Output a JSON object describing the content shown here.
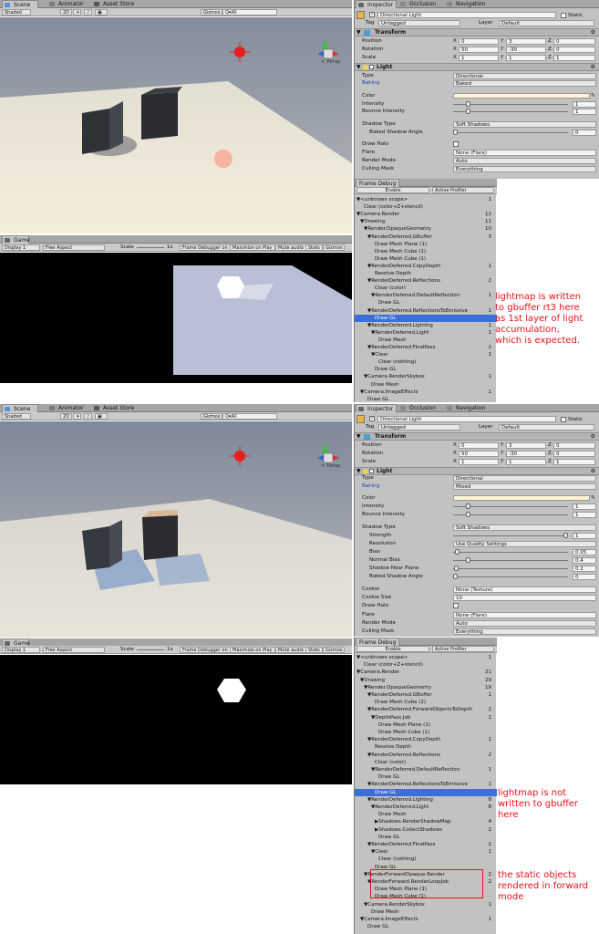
{
  "panelA": {
    "scene_tabs": [
      "Scene",
      "Animator",
      "Asset Store"
    ],
    "scene_toolbar": {
      "shading": "Shaded",
      "mode2d": "2D",
      "gizmos": "Gizmos",
      "search": "Q▾All"
    },
    "persp": "< Persp",
    "game_tab": "Game",
    "game_toolbar": {
      "display": "Display 1",
      "aspect": "Free Aspect",
      "scale": "Scale",
      "scale_val": "1x",
      "frame_debugger": "Frame Debugger on",
      "max_on_play": "Maximize on Play",
      "mute": "Mute audio",
      "stats": "Stats",
      "gizmos": "Gizmos"
    },
    "inspector_tabs": [
      "Inspector",
      "Occlusion",
      "Navigation"
    ],
    "object_name": "Directional Light",
    "static": "Static",
    "tag_label": "Tag",
    "tag": "Untagged",
    "layer_label": "Layer",
    "layer": "Default",
    "transform": {
      "title": "Transform",
      "position": "Position",
      "rotation": "Rotation",
      "scale": "Scale",
      "px": "0",
      "py": "3",
      "pz": "0",
      "rx": "50",
      "ry": "-30",
      "rz": "0",
      "sx": "1",
      "sy": "1",
      "sz": "1"
    },
    "light": {
      "title": "Light",
      "type_label": "Type",
      "type": "Directional",
      "baking_label": "Baking",
      "baking": "Baked",
      "color": "Color",
      "intensity": "Intensity",
      "intensity_val": "1",
      "bounce": "Bounce Intensity",
      "bounce_val": "1",
      "shadow_type": "Shadow Type",
      "shadow_type_val": "Soft Shadows",
      "baked_angle": "Baked Shadow Angle",
      "baked_angle_val": "0",
      "draw_halo": "Draw Halo",
      "flare": "Flare",
      "flare_val": "None (Flare)",
      "render_mode": "Render Mode",
      "render_mode_val": "Auto",
      "culling": "Culling Mask",
      "culling_val": "Everything"
    },
    "frame_debug": {
      "title": "Frame Debug",
      "enable": "Enable",
      "profiler": "Active Profiler",
      "rows": [
        {
          "t": "▼<unknown scope>",
          "n": "1",
          "d": 0
        },
        {
          "t": "Clear (color+Z+stencil)",
          "n": "",
          "d": 2
        },
        {
          "t": "▼Camera.Render",
          "n": "12",
          "d": 0
        },
        {
          "t": "▼Drawing",
          "n": "11",
          "d": 1
        },
        {
          "t": "▼Render.OpaqueGeometry",
          "n": "10",
          "d": 2
        },
        {
          "t": "▼RenderDeferred.GBuffer",
          "n": "3",
          "d": 3
        },
        {
          "t": "Draw Mesh Plane (1)",
          "n": "",
          "d": 5
        },
        {
          "t": "Draw Mesh Cube (1)",
          "n": "",
          "d": 5
        },
        {
          "t": "Draw Mesh Cube (1)",
          "n": "",
          "d": 5
        },
        {
          "t": "▼RenderDeferred.CopyDepth",
          "n": "1",
          "d": 3
        },
        {
          "t": "Resolve Depth",
          "n": "",
          "d": 5
        },
        {
          "t": "▼RenderDeferred.Reflections",
          "n": "2",
          "d": 3
        },
        {
          "t": "Clear (color)",
          "n": "",
          "d": 5
        },
        {
          "t": "▼RenderDeferred.DefaultReflection",
          "n": "1",
          "d": 4
        },
        {
          "t": "Draw GL",
          "n": "",
          "d": 6
        },
        {
          "t": "▼RenderDeferred.ReflectionsToEmissive",
          "n": "1",
          "d": 3
        },
        {
          "t": "Draw GL",
          "n": "",
          "d": 5,
          "sel": true
        },
        {
          "t": "▼RenderDeferred.Lighting",
          "n": "1",
          "d": 3
        },
        {
          "t": "▼RenderDeferred.Light",
          "n": "1",
          "d": 4
        },
        {
          "t": "Draw Mesh",
          "n": "",
          "d": 6
        },
        {
          "t": "▼RenderDeferred.FinalPass",
          "n": "2",
          "d": 3
        },
        {
          "t": "▼Clear",
          "n": "1",
          "d": 4
        },
        {
          "t": "Clear (nothing)",
          "n": "",
          "d": 6
        },
        {
          "t": "Draw GL",
          "n": "",
          "d": 5
        },
        {
          "t": "▼Camera.RenderSkybox",
          "n": "1",
          "d": 2
        },
        {
          "t": "Draw Mesh",
          "n": "",
          "d": 4
        },
        {
          "t": "▼Camera.ImageEffects",
          "n": "1",
          "d": 1
        },
        {
          "t": "Draw GL",
          "n": "",
          "d": 3
        }
      ]
    },
    "note": "lightmap is written\nto gbuffer rt3 here\nas 1st layer of light\naccumulation,\nwhich is expected."
  },
  "panelB": {
    "scene_tabs": [
      "Scene",
      "Animator",
      "Asset Store"
    ],
    "scene_toolbar": {
      "shading": "Shaded",
      "mode2d": "2D",
      "gizmos": "Gizmos",
      "search": "Q▾All"
    },
    "persp": "< Persp",
    "game_tab": "Game",
    "game_toolbar": {
      "display": "Display 1",
      "aspect": "Free Aspect",
      "scale": "Scale",
      "scale_val": "1x",
      "frame_debugger": "Frame Debugger on",
      "max_on_play": "Maximize on Play",
      "mute": "Mute audio",
      "stats": "Stats",
      "gizmos": "Gizmos"
    },
    "inspector_tabs": [
      "Inspector",
      "Occlusion",
      "Navigation"
    ],
    "object_name": "Directional Light",
    "static": "Static",
    "tag_label": "Tag",
    "tag": "Untagged",
    "layer_label": "Layer",
    "layer": "Default",
    "transform": {
      "title": "Transform",
      "position": "Position",
      "rotation": "Rotation",
      "scale": "Scale",
      "px": "0",
      "py": "3",
      "pz": "0",
      "rx": "50",
      "ry": "-30",
      "rz": "0",
      "sx": "1",
      "sy": "1",
      "sz": "1"
    },
    "light": {
      "title": "Light",
      "type_label": "Type",
      "type": "Directional",
      "baking_label": "Baking",
      "baking": "Mixed",
      "color": "Color",
      "intensity": "Intensity",
      "intensity_val": "1",
      "bounce": "Bounce Intensity",
      "bounce_val": "1",
      "shadow_type": "Shadow Type",
      "shadow_type_val": "Soft Shadows",
      "strength": "Strength",
      "strength_val": "1",
      "resolution": "Resolution",
      "resolution_val": "Use Quality Settings",
      "bias": "Bias",
      "bias_val": "0.05",
      "normal_bias": "Normal Bias",
      "normal_bias_val": "0.4",
      "near_plane": "Shadow Near Plane",
      "near_plane_val": "0.2",
      "baked_angle": "Baked Shadow Angle",
      "baked_angle_val": "0",
      "cookie": "Cookie",
      "cookie_val": "None (Texture)",
      "cookie_size": "Cookie Size",
      "cookie_size_val": "10",
      "draw_halo": "Draw Halo",
      "flare": "Flare",
      "flare_val": "None (Flare)",
      "render_mode": "Render Mode",
      "render_mode_val": "Auto",
      "culling": "Culling Mask",
      "culling_val": "Everything"
    },
    "frame_debug": {
      "title": "Frame Debug",
      "enable": "Enable",
      "profiler": "Active Profiler",
      "rows": [
        {
          "t": "▼<unknown scope>",
          "n": "1",
          "d": 0
        },
        {
          "t": "Clear (color+Z+stencil)",
          "n": "",
          "d": 2
        },
        {
          "t": "▼Camera.Render",
          "n": "21",
          "d": 0
        },
        {
          "t": "▼Drawing",
          "n": "20",
          "d": 1
        },
        {
          "t": "▼Render.OpaqueGeometry",
          "n": "19",
          "d": 2
        },
        {
          "t": "▼RenderDeferred.GBuffer",
          "n": "1",
          "d": 3
        },
        {
          "t": "Draw Mesh Cube (2)",
          "n": "",
          "d": 5
        },
        {
          "t": "▼RenderDeferred.ForwardObjectsToDepth",
          "n": "2",
          "d": 3
        },
        {
          "t": "▼DepthPass.Job",
          "n": "2",
          "d": 4
        },
        {
          "t": "Draw Mesh Plane (1)",
          "n": "",
          "d": 6
        },
        {
          "t": "Draw Mesh Cube (1)",
          "n": "",
          "d": 6
        },
        {
          "t": "▼RenderDeferred.CopyDepth",
          "n": "1",
          "d": 3
        },
        {
          "t": "Resolve Depth",
          "n": "",
          "d": 5
        },
        {
          "t": "▼RenderDeferred.Reflections",
          "n": "2",
          "d": 3
        },
        {
          "t": "Clear (color)",
          "n": "",
          "d": 5
        },
        {
          "t": "▼RenderDeferred.DefaultReflection",
          "n": "1",
          "d": 4
        },
        {
          "t": "Draw GL",
          "n": "",
          "d": 6
        },
        {
          "t": "▼RenderDeferred.ReflectionsToEmissive",
          "n": "1",
          "d": 3
        },
        {
          "t": "Draw GL",
          "n": "",
          "d": 5,
          "sel": true
        },
        {
          "t": "▼RenderDeferred.Lighting",
          "n": "8",
          "d": 3
        },
        {
          "t": "▼RenderDeferred.Light",
          "n": "8",
          "d": 4
        },
        {
          "t": "Draw Mesh",
          "n": "",
          "d": 6
        },
        {
          "t": "▶Shadows.RenderShadowMap",
          "n": "4",
          "d": 5
        },
        {
          "t": "▶Shadows.CollectShadows",
          "n": "2",
          "d": 5
        },
        {
          "t": "Draw GL",
          "n": "",
          "d": 6
        },
        {
          "t": "▼RenderDeferred.FinalPass",
          "n": "2",
          "d": 3
        },
        {
          "t": "▼Clear",
          "n": "1",
          "d": 4
        },
        {
          "t": "Clear (nothing)",
          "n": "",
          "d": 6
        },
        {
          "t": "Draw GL",
          "n": "",
          "d": 5
        },
        {
          "t": "▼RenderForwardOpaque.Render",
          "n": "2",
          "d": 2
        },
        {
          "t": "▼RenderForward.RenderLoopJob",
          "n": "2",
          "d": 3
        },
        {
          "t": "Draw Mesh Plane (1)",
          "n": "",
          "d": 5
        },
        {
          "t": "Draw Mesh Cube (1)",
          "n": "",
          "d": 5
        },
        {
          "t": "▼Camera.RenderSkybox",
          "n": "1",
          "d": 2
        },
        {
          "t": "Draw Mesh",
          "n": "",
          "d": 4
        },
        {
          "t": "▼Camera.ImageEffects",
          "n": "1",
          "d": 1
        },
        {
          "t": "Draw GL",
          "n": "",
          "d": 3
        }
      ]
    },
    "note1": "lightmap is not\nwritten to gbuffer\nhere",
    "note2": "the static objects\nrendered in forward\nmode"
  }
}
